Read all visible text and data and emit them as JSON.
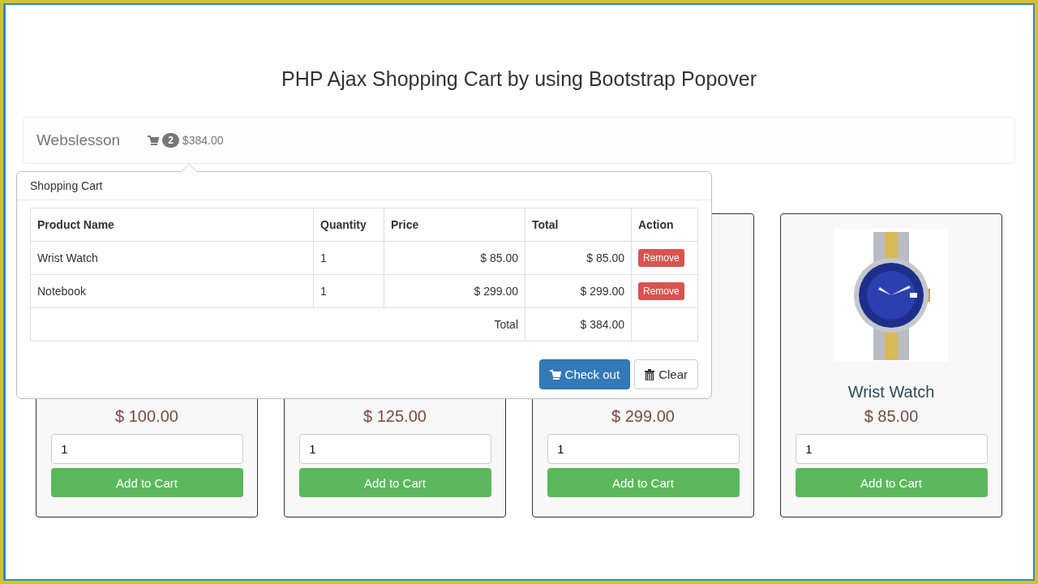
{
  "title": "PHP Ajax Shopping Cart by using Bootstrap Popover",
  "navbar": {
    "brand": "Webslesson",
    "cart_count": "2",
    "cart_total": "$384.00"
  },
  "popover": {
    "title": "Shopping Cart",
    "columns": [
      "Product Name",
      "Quantity",
      "Price",
      "Total",
      "Action"
    ],
    "rows": [
      {
        "name": "Wrist Watch",
        "quantity": "1",
        "price": "$ 85.00",
        "total": "$ 85.00",
        "action": "Remove"
      },
      {
        "name": "Notebook",
        "quantity": "1",
        "price": "$ 299.00",
        "total": "$ 299.00",
        "action": "Remove"
      }
    ],
    "total_label": "Total",
    "total": "$ 384.00",
    "buttons": [
      {
        "label": "Check out",
        "kind": "checkout"
      },
      {
        "label": "Clear",
        "kind": "clear"
      }
    ]
  },
  "products": [
    {
      "price": "$ 100.00",
      "quantity": "1",
      "button": "Add to Cart"
    },
    {
      "price": "$ 125.00",
      "quantity": "1",
      "button": "Add to Cart"
    },
    {
      "price": "$ 299.00",
      "quantity": "1",
      "button": "Add to Cart"
    },
    {
      "name": "Wrist Watch",
      "price": "$ 85.00",
      "quantity": "1",
      "button": "Add to Cart"
    }
  ]
}
